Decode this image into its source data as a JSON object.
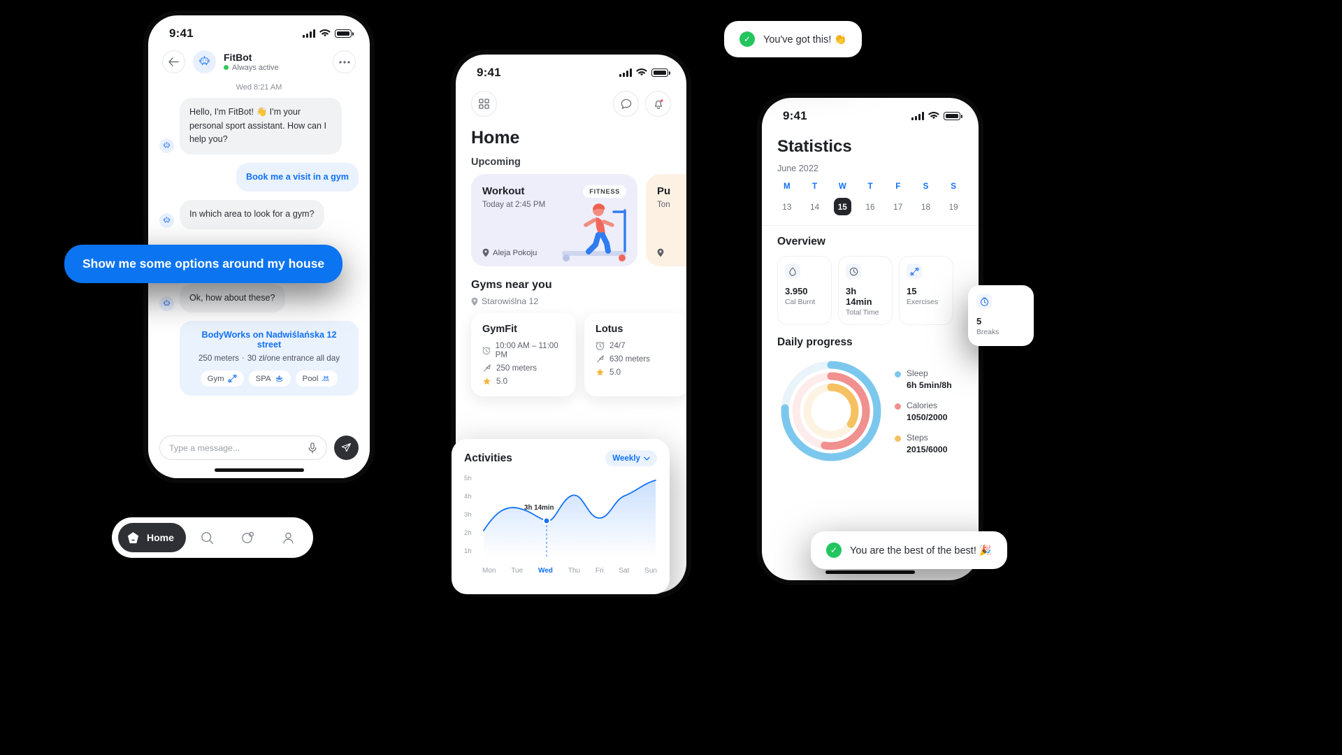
{
  "chat_screen": {
    "status_time": "9:41",
    "back_icon": "arrow-left-icon",
    "bot_name": "FitBot",
    "bot_status": "Always active",
    "more_icon": "more-dots-icon",
    "timestamp": "Wed 8:21 AM",
    "messages": [
      {
        "from": "bot",
        "text": "Hello, I'm FitBot! 👋 I'm your personal sport assistant. How can I help you?"
      },
      {
        "from": "user_quick",
        "text": "Book me a visit in a gym"
      },
      {
        "from": "bot",
        "text": "In which area to look for a gym?"
      },
      {
        "from": "bot",
        "text": "Ok, how about these?"
      }
    ],
    "floating_message": "Show me some options around my house",
    "gym_card": {
      "title": "BodyWorks on Nadwiślańska 12 street",
      "distance": "250 meters",
      "separator": "·",
      "price": "30 zł/one entrance all day",
      "tags": [
        {
          "label": "Gym",
          "icon": "dumbbell-icon"
        },
        {
          "label": "SPA",
          "icon": "lotus-icon"
        },
        {
          "label": "Pool",
          "icon": "pool-icon"
        }
      ]
    },
    "composer": {
      "placeholder": "Type a message...",
      "mic_icon": "microphone-icon",
      "send_icon": "paper-plane-icon"
    }
  },
  "home_screen": {
    "status_time": "9:41",
    "grid_icon": "grid-apps-icon",
    "chat_icon": "chat-bubble-icon",
    "bell_icon": "bell-notification-icon",
    "title": "Home",
    "upcoming_label": "Upcoming",
    "upcoming_cards": [
      {
        "title": "Workout",
        "subtitle": "Today at 2:45 PM",
        "badge": "FITNESS",
        "location": "Aleja Pokoju"
      },
      {
        "title": "Pu",
        "subtitle": "Ton",
        "badge": "",
        "location": ""
      }
    ],
    "near_title": "Gyms near you",
    "near_address": "Starowiślna 12",
    "gyms": [
      {
        "name": "GymFit",
        "hours": "10:00 AM – 11:00 PM",
        "distance": "250 meters",
        "rating": "5.0"
      },
      {
        "name": "Lotus",
        "hours": "24/7",
        "distance": "630 meters",
        "rating": "5.0"
      }
    ]
  },
  "activities_card": {
    "title": "Activities",
    "period_label": "Weekly",
    "period_chevron": "chevron-down-icon",
    "tooltip_value": "3h 14min"
  },
  "stats_screen": {
    "status_time": "9:41",
    "title": "Statistics",
    "month": "June 2022",
    "weekday_initials": [
      "M",
      "T",
      "W",
      "T",
      "F",
      "S",
      "S"
    ],
    "days": [
      "13",
      "14",
      "15",
      "16",
      "17",
      "18",
      "19"
    ],
    "selected_day": "15",
    "overview_label": "Overview",
    "overview_cards": [
      {
        "value": "3.950",
        "label": "Cal Burnt",
        "icon": "flame-drop-icon"
      },
      {
        "value": "3h 14min",
        "label": "Total Time",
        "icon": "clock-icon"
      },
      {
        "value": "15",
        "label": "Exercises",
        "icon": "dumbbell-icon"
      }
    ],
    "breaks_card": {
      "value": "5",
      "label": "Breaks",
      "icon": "stopwatch-icon"
    },
    "daily_progress_label": "Daily progress",
    "legend": [
      {
        "name": "Sleep",
        "value": "6h 5min/8h",
        "color": "#7cc7ee"
      },
      {
        "name": "Calories",
        "value": "1050/2000",
        "color": "#f0908f"
      },
      {
        "name": "Steps",
        "value": "2015/6000",
        "color": "#f5c161"
      }
    ]
  },
  "toasts": [
    {
      "icon": "check-circle-icon",
      "text": "You've got this! 👏"
    },
    {
      "icon": "check-circle-icon",
      "text": "You are the best of the best! 🎉"
    }
  ],
  "bottom_nav": {
    "active_label": "Home",
    "items": [
      {
        "name": "home",
        "icon": "home-icon"
      },
      {
        "name": "search",
        "icon": "search-icon"
      },
      {
        "name": "stats",
        "icon": "pie-chart-icon"
      },
      {
        "name": "profile",
        "icon": "person-icon"
      }
    ]
  },
  "chart_data": {
    "type": "area",
    "title": "Activities",
    "categories": [
      "Mon",
      "Tue",
      "Wed",
      "Thu",
      "Fri",
      "Sat",
      "Sun"
    ],
    "values": [
      2.6,
      3.0,
      3.2,
      3.9,
      3.1,
      3.7,
      4.8
    ],
    "ylabel": "",
    "xlabel": "",
    "ytick_labels": [
      "5h",
      "4h",
      "3h",
      "2h",
      "1h"
    ],
    "ylim": [
      1,
      5
    ],
    "highlight_category": "Wed",
    "highlight_label": "3h 14min",
    "line_color": "#1271f5",
    "grid": false,
    "legend": "none"
  },
  "rings_data": {
    "type": "pie",
    "title": "Daily progress",
    "series": [
      {
        "name": "Sleep",
        "value": 6.083,
        "max": 8,
        "percent": 76,
        "color": "#7cc7ee"
      },
      {
        "name": "Calories",
        "value": 1050,
        "max": 2000,
        "percent": 53,
        "color": "#f0908f"
      },
      {
        "name": "Steps",
        "value": 2015,
        "max": 6000,
        "percent": 34,
        "color": "#f5c161"
      }
    ]
  },
  "colors": {
    "accent_blue": "#1271f5",
    "quick_reply_bg": "#eaf2fe",
    "bot_bubble_bg": "#f1f2f4",
    "workout_card_bg": "#eeeefb",
    "pulse_card_bg": "#fdf1e4",
    "dark": "#2e3035",
    "green": "#22c55e",
    "star": "#f5b63f"
  }
}
